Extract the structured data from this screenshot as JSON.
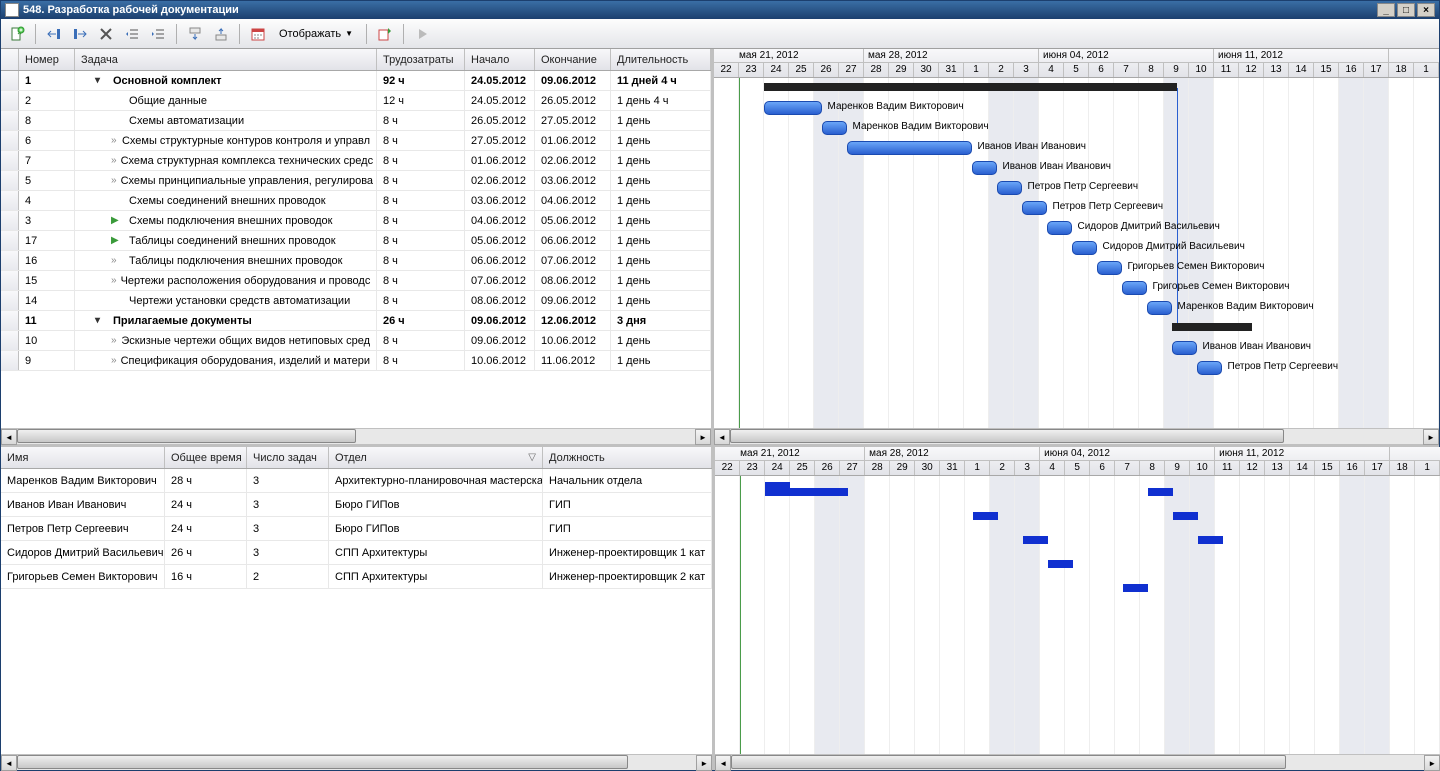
{
  "window": {
    "title": "548. Разработка рабочей документации"
  },
  "toolbar": {
    "display_label": "Отображать"
  },
  "task_cols": {
    "num": "Номер",
    "task": "Задача",
    "effort": "Трудозатраты",
    "start": "Начало",
    "end": "Окончание",
    "dur": "Длительность"
  },
  "res_cols": {
    "name": "Имя",
    "total": "Общее время",
    "count": "Число задач",
    "dept": "Отдел",
    "pos": "Должность"
  },
  "time": {
    "months": [
      {
        "label": "мая 21, 2012",
        "span": 7
      },
      {
        "label": "мая 28, 2012",
        "span": 7
      },
      {
        "label": "июня 04, 2012",
        "span": 7
      },
      {
        "label": "июня 11, 2012",
        "span": 7
      }
    ],
    "days": [
      "22",
      "23",
      "24",
      "25",
      "26",
      "27",
      "28",
      "29",
      "30",
      "31",
      "1",
      "2",
      "3",
      "4",
      "5",
      "6",
      "7",
      "8",
      "9",
      "10",
      "11",
      "12",
      "13",
      "14",
      "15",
      "16",
      "17",
      "18",
      "1"
    ],
    "weekend_idx": [
      4,
      5,
      11,
      12,
      18,
      19,
      25,
      26
    ],
    "today_idx": 1
  },
  "tasks": [
    {
      "num": "1",
      "name": "Основной комплект",
      "effort": "92 ч",
      "start": "24.05.2012",
      "end": "09.06.2012",
      "dur": "11 дней 4 ч",
      "indent": 0,
      "summary": true,
      "bar": {
        "col": 2,
        "span": 16.5
      }
    },
    {
      "num": "2",
      "name": "Общие данные",
      "effort": "12 ч",
      "start": "24.05.2012",
      "end": "26.05.2012",
      "dur": "1 день 4 ч",
      "indent": 1,
      "bar": {
        "col": 2,
        "span": 2.3,
        "label": "Маренков Вадим Викторович"
      }
    },
    {
      "num": "8",
      "name": "Схемы автоматизации",
      "effort": "8 ч",
      "start": "26.05.2012",
      "end": "27.05.2012",
      "dur": "1 день",
      "indent": 1,
      "bar": {
        "col": 4.3,
        "span": 1,
        "label": "Маренков Вадим Викторович"
      }
    },
    {
      "num": "6",
      "name": "Схемы структурные контуров контроля и управл",
      "effort": "8 ч",
      "start": "27.05.2012",
      "end": "01.06.2012",
      "dur": "1 день",
      "indent": 1,
      "icon": "dbl",
      "bar": {
        "col": 5.3,
        "span": 5,
        "label": "Иванов Иван Иванович"
      }
    },
    {
      "num": "7",
      "name": "Схема структурная комплекса технических средс",
      "effort": "8 ч",
      "start": "01.06.2012",
      "end": "02.06.2012",
      "dur": "1 день",
      "indent": 1,
      "icon": "dbl",
      "bar": {
        "col": 10.3,
        "span": 1,
        "label": "Иванов Иван Иванович"
      }
    },
    {
      "num": "5",
      "name": "Схемы принципиальные управления, регулирова",
      "effort": "8 ч",
      "start": "02.06.2012",
      "end": "03.06.2012",
      "dur": "1 день",
      "indent": 1,
      "icon": "dbl",
      "bar": {
        "col": 11.3,
        "span": 1,
        "label": "Петров Петр Сергеевич"
      }
    },
    {
      "num": "4",
      "name": "Схемы соединений внешних проводок",
      "effort": "8 ч",
      "start": "03.06.2012",
      "end": "04.06.2012",
      "dur": "1 день",
      "indent": 1,
      "bar": {
        "col": 12.3,
        "span": 1,
        "label": "Петров Петр Сергеевич"
      }
    },
    {
      "num": "3",
      "name": "Схемы подключения внешних проводок",
      "effort": "8 ч",
      "start": "04.06.2012",
      "end": "05.06.2012",
      "dur": "1 день",
      "indent": 1,
      "icon": "play",
      "bar": {
        "col": 13.3,
        "span": 1,
        "label": "Сидоров Дмитрий Васильевич"
      }
    },
    {
      "num": "17",
      "name": "Таблицы соединений внешних проводок",
      "effort": "8 ч",
      "start": "05.06.2012",
      "end": "06.06.2012",
      "dur": "1 день",
      "indent": 1,
      "icon": "play",
      "bar": {
        "col": 14.3,
        "span": 1,
        "label": "Сидоров Дмитрий Васильевич"
      }
    },
    {
      "num": "16",
      "name": "Таблицы подключения внешних проводок",
      "effort": "8 ч",
      "start": "06.06.2012",
      "end": "07.06.2012",
      "dur": "1 день",
      "indent": 1,
      "icon": "dbl",
      "bar": {
        "col": 15.3,
        "span": 1,
        "label": "Григорьев Семен Викторович"
      }
    },
    {
      "num": "15",
      "name": "Чертежи расположения оборудования и проводс",
      "effort": "8 ч",
      "start": "07.06.2012",
      "end": "08.06.2012",
      "dur": "1 день",
      "indent": 1,
      "icon": "dbl",
      "bar": {
        "col": 16.3,
        "span": 1,
        "label": "Григорьев Семен Викторович"
      }
    },
    {
      "num": "14",
      "name": "Чертежи установки средств автоматизации",
      "effort": "8 ч",
      "start": "08.06.2012",
      "end": "09.06.2012",
      "dur": "1 день",
      "indent": 1,
      "bar": {
        "col": 17.3,
        "span": 1,
        "label": "Маренков Вадим Викторович"
      }
    },
    {
      "num": "11",
      "name": "Прилагаемые документы",
      "effort": "26 ч",
      "start": "09.06.2012",
      "end": "12.06.2012",
      "dur": "3 дня",
      "indent": 0,
      "summary": true,
      "bar": {
        "col": 18.3,
        "span": 3.2
      }
    },
    {
      "num": "10",
      "name": "Эскизные чертежи общих видов нетиповых сред",
      "effort": "8 ч",
      "start": "09.06.2012",
      "end": "10.06.2012",
      "dur": "1 день",
      "indent": 1,
      "icon": "dbl",
      "bar": {
        "col": 18.3,
        "span": 1,
        "label": "Иванов Иван Иванович"
      }
    },
    {
      "num": "9",
      "name": "Спецификация оборудования, изделий и матери",
      "effort": "8 ч",
      "start": "10.06.2012",
      "end": "11.06.2012",
      "dur": "1 день",
      "indent": 1,
      "icon": "dbl",
      "bar": {
        "col": 19.3,
        "span": 1,
        "label": "Петров Петр Сергеевич"
      }
    }
  ],
  "resources": [
    {
      "name": "Маренков Вадим Викторович",
      "total": "28 ч",
      "count": "3",
      "dept": "Архитектурно-планировочная мастерская",
      "pos": "Начальник отдела",
      "bars": [
        {
          "col": 2,
          "span": 1,
          "h": 1
        },
        {
          "col": 3,
          "span": 1.3,
          "h": 0.5
        },
        {
          "col": 4.3,
          "span": 1,
          "h": 0.5
        },
        {
          "col": 17.3,
          "span": 1,
          "h": 0.5
        }
      ]
    },
    {
      "name": "Иванов Иван Иванович",
      "total": "24 ч",
      "count": "3",
      "dept": "Бюро ГИПов",
      "pos": "ГИП",
      "bars": [
        {
          "col": 10.3,
          "span": 1,
          "h": 0.5
        },
        {
          "col": 18.3,
          "span": 1,
          "h": 0.5
        }
      ]
    },
    {
      "name": "Петров Петр Сергеевич",
      "total": "24 ч",
      "count": "3",
      "dept": "Бюро ГИПов",
      "pos": "ГИП",
      "bars": [
        {
          "col": 12.3,
          "span": 1,
          "h": 0.5
        },
        {
          "col": 19.3,
          "span": 1,
          "h": 0.5
        }
      ]
    },
    {
      "name": "Сидоров Дмитрий Васильевич",
      "total": "26 ч",
      "count": "3",
      "dept": "СПП Архитектуры",
      "pos": "Инженер-проектировщик 1 кат",
      "bars": [
        {
          "col": 13.3,
          "span": 1,
          "h": 0.5
        }
      ]
    },
    {
      "name": "Григорьев Семен Викторович",
      "total": "16 ч",
      "count": "2",
      "dept": "СПП Архитектуры",
      "pos": "Инженер-проектировщик 2 кат",
      "bars": [
        {
          "col": 16.3,
          "span": 1,
          "h": 0.5
        }
      ]
    }
  ]
}
